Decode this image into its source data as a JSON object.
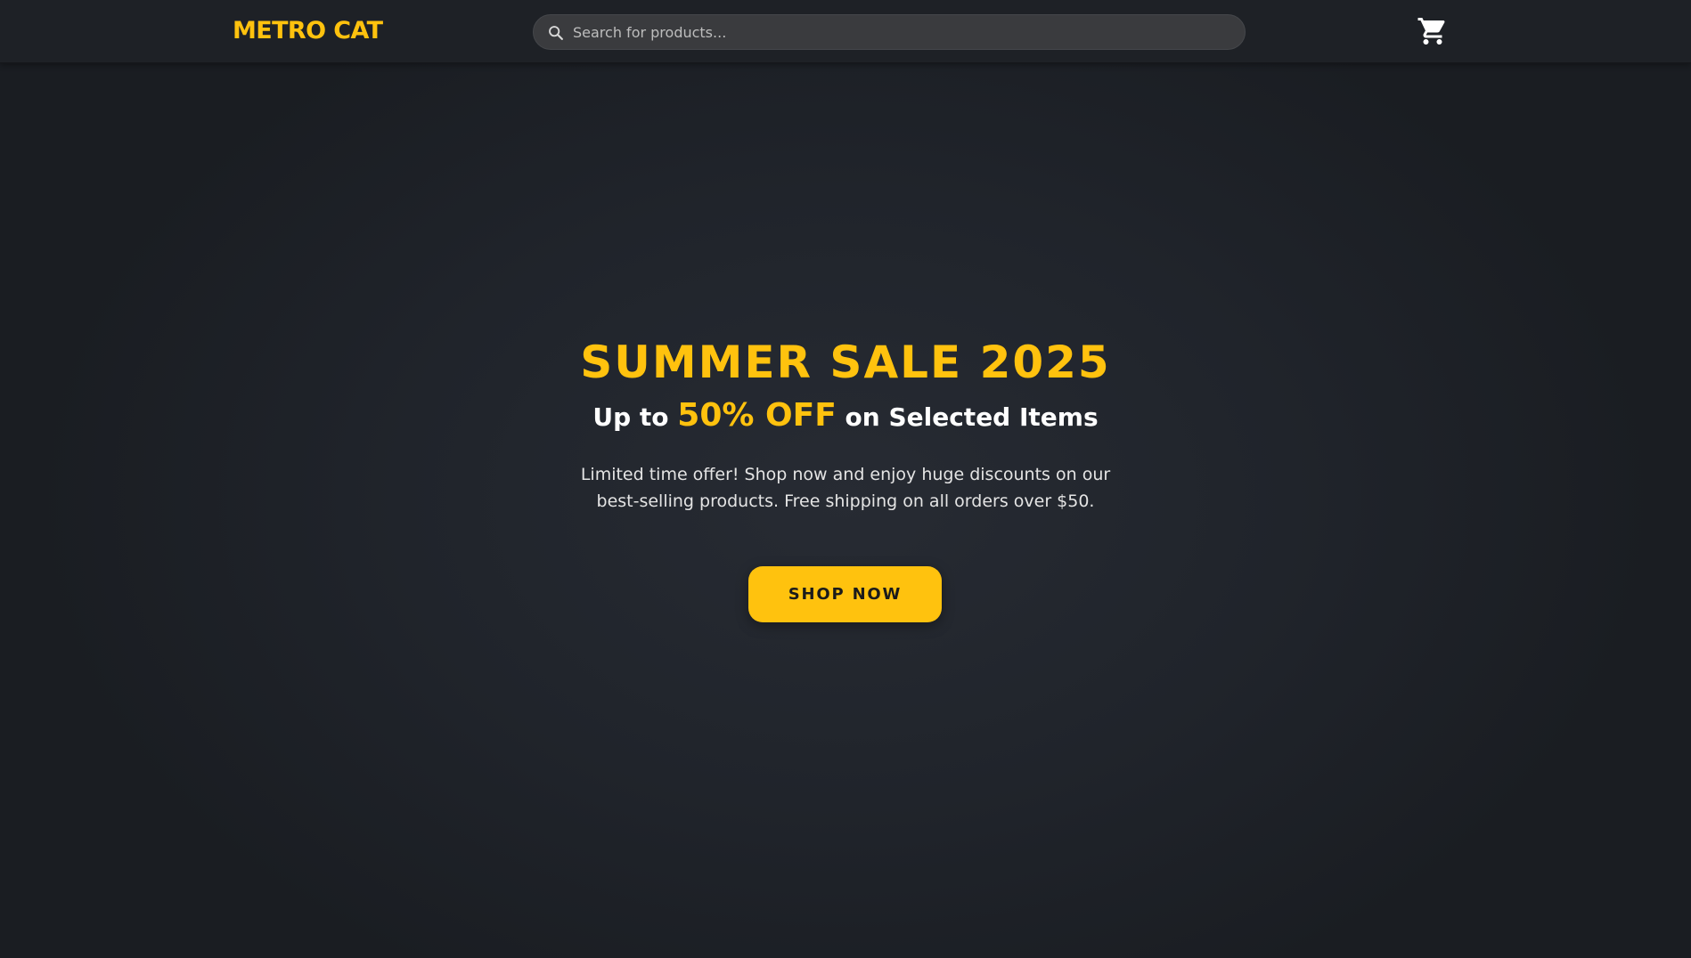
{
  "header": {
    "logo": "METRO CAT",
    "search": {
      "placeholder": "Search for products...",
      "value": ""
    },
    "cart_icon": "cart-icon"
  },
  "hero": {
    "title": "SUMMER SALE 2025",
    "subtitle_prefix": "Up to",
    "subtitle_highlight": "50% OFF",
    "subtitle_suffix": "on Selected Items",
    "description_line1": "Limited time offer! Shop now and enjoy huge discounts on our",
    "description_line2": "best-selling products. Free shipping on all orders over $50.",
    "cta_label": "SHOP NOW"
  },
  "colors": {
    "accent": "#ffc20e",
    "background": "#1b1e24",
    "navbar": "#1e2126",
    "search_bg": "#3a3b3e",
    "text": "#ffffff"
  }
}
